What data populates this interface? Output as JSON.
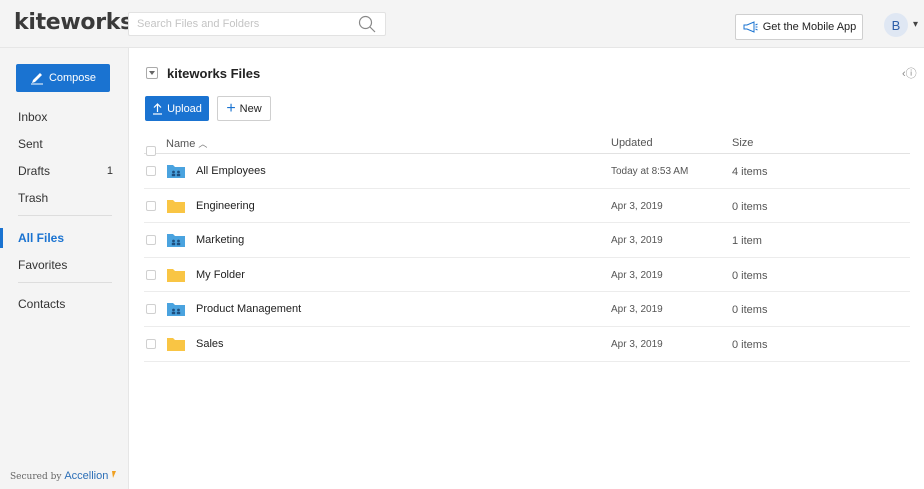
{
  "header": {
    "logo": "kiteworks",
    "search_placeholder": "Search Files and Folders",
    "mobile_app_label": "Get the Mobile App",
    "avatar_initial": "B",
    "avatar_caret": "▾"
  },
  "sidebar": {
    "compose_label": "Compose",
    "items": [
      {
        "label": "Inbox",
        "count": ""
      },
      {
        "label": "Sent",
        "count": ""
      },
      {
        "label": "Drafts",
        "count": "1"
      },
      {
        "label": "Trash",
        "count": ""
      },
      {
        "label": "All Files",
        "count": ""
      },
      {
        "label": "Favorites",
        "count": ""
      },
      {
        "label": "Contacts",
        "count": ""
      }
    ],
    "secured_prefix": "Secured by",
    "secured_brand": "Accellion"
  },
  "main": {
    "folder_title": "kiteworks Files",
    "info_glyph": "‹ⓘ",
    "upload_label": "Upload",
    "new_label": "New",
    "columns": {
      "name": "Name",
      "updated": "Updated",
      "size": "Size"
    },
    "rows": [
      {
        "name": "All Employees",
        "updated": "Today at 8:53 AM",
        "size": "4 items",
        "shared": true
      },
      {
        "name": "Engineering",
        "updated": "Apr 3, 2019",
        "size": "0 items",
        "shared": false
      },
      {
        "name": "Marketing",
        "updated": "Apr 3, 2019",
        "size": "1 item",
        "shared": true
      },
      {
        "name": "My Folder",
        "updated": "Apr 3, 2019",
        "size": "0 items",
        "shared": false
      },
      {
        "name": "Product Management",
        "updated": "Apr 3, 2019",
        "size": "0 items",
        "shared": true
      },
      {
        "name": "Sales",
        "updated": "Apr 3, 2019",
        "size": "0 items",
        "shared": false
      }
    ]
  },
  "colors": {
    "accent": "#1a73d1",
    "sidebar_bg": "#f4f4f4",
    "folder_yellow": "#f9c544",
    "folder_blue": "#4aa3df"
  }
}
